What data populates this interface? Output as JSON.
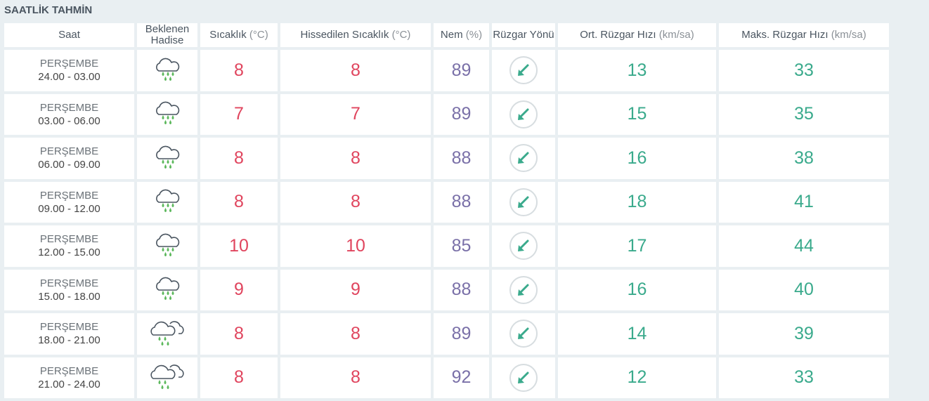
{
  "section_title": "SAATLİK TAHMİN",
  "headers": {
    "saat": "Saat",
    "hadise_1": "Beklenen",
    "hadise_2": "Hadise",
    "sicaklik": "Sıcaklık",
    "sicaklik_unit": "(°C)",
    "hissedilen": "Hissedilen Sıcaklık",
    "hissedilen_unit": "(°C)",
    "nem": "Nem",
    "nem_unit": "(%)",
    "ruzgar_yonu": "Rüzgar Yönü",
    "ort_ruzgar": "Ort. Rüzgar Hızı",
    "ort_ruzgar_unit": "(km/sa)",
    "maks_ruzgar": "Maks. Rüzgar Hızı",
    "maks_ruzgar_unit": "(km/sa)"
  },
  "colors": {
    "temperature": "#e0455e",
    "humidity": "#7a70a8",
    "wind": "#3aaa8c",
    "rain_drop": "#5cb85c"
  },
  "rows": [
    {
      "day": "PERŞEMBE",
      "range": "24.00 - 03.00",
      "icon": "rain-cloud-icon",
      "sicaklik": "8",
      "hissedilen": "8",
      "nem": "89",
      "yon_icon": "wind-arrow-sw-icon",
      "ort": "13",
      "maks": "33"
    },
    {
      "day": "PERŞEMBE",
      "range": "03.00 - 06.00",
      "icon": "rain-cloud-icon",
      "sicaklik": "7",
      "hissedilen": "7",
      "nem": "89",
      "yon_icon": "wind-arrow-sw-icon",
      "ort": "15",
      "maks": "35"
    },
    {
      "day": "PERŞEMBE",
      "range": "06.00 - 09.00",
      "icon": "rain-cloud-icon",
      "sicaklik": "8",
      "hissedilen": "8",
      "nem": "88",
      "yon_icon": "wind-arrow-sw-icon",
      "ort": "16",
      "maks": "38"
    },
    {
      "day": "PERŞEMBE",
      "range": "09.00 - 12.00",
      "icon": "rain-cloud-icon",
      "sicaklik": "8",
      "hissedilen": "8",
      "nem": "88",
      "yon_icon": "wind-arrow-sw-icon",
      "ort": "18",
      "maks": "41"
    },
    {
      "day": "PERŞEMBE",
      "range": "12.00 - 15.00",
      "icon": "rain-cloud-icon",
      "sicaklik": "10",
      "hissedilen": "10",
      "nem": "85",
      "yon_icon": "wind-arrow-sw-icon",
      "ort": "17",
      "maks": "44"
    },
    {
      "day": "PERŞEMBE",
      "range": "15.00 - 18.00",
      "icon": "rain-cloud-icon",
      "sicaklik": "9",
      "hissedilen": "9",
      "nem": "88",
      "yon_icon": "wind-arrow-sw-icon",
      "ort": "16",
      "maks": "40"
    },
    {
      "day": "PERŞEMBE",
      "range": "18.00 - 21.00",
      "icon": "rain-double-cloud-icon",
      "sicaklik": "8",
      "hissedilen": "8",
      "nem": "89",
      "yon_icon": "wind-arrow-sw-icon",
      "ort": "14",
      "maks": "39"
    },
    {
      "day": "PERŞEMBE",
      "range": "21.00 - 24.00",
      "icon": "rain-double-cloud-icon",
      "sicaklik": "8",
      "hissedilen": "8",
      "nem": "92",
      "yon_icon": "wind-arrow-sw-icon",
      "ort": "12",
      "maks": "33"
    }
  ]
}
